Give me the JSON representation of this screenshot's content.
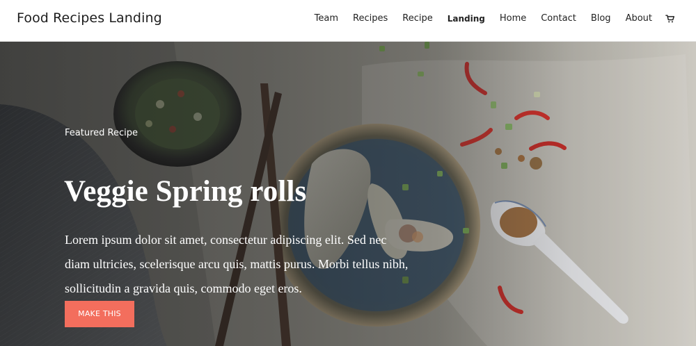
{
  "site": {
    "title": "Food Recipes Landing"
  },
  "nav": {
    "items": [
      {
        "label": "Team"
      },
      {
        "label": "Recipes"
      },
      {
        "label": "Recipe"
      },
      {
        "label": "Landing"
      },
      {
        "label": "Home"
      },
      {
        "label": "Contact"
      },
      {
        "label": "Blog"
      },
      {
        "label": "About"
      }
    ],
    "active": "Landing",
    "cart_icon": "cart-icon"
  },
  "hero": {
    "eyebrow": "Featured Recipe",
    "title": "Veggie Spring rolls",
    "body": "Lorem ipsum dolor sit amet, consectetur adipiscing elit. Sed nec diam ultricies, scelerisque arcu quis, mattis purus. Morbi tellus nibh, sollicitudin a gravida quis, commodo eget eros.",
    "cta_label": "MAKE THIS"
  },
  "colors": {
    "accent": "#f36e5d",
    "header_bg": "#ffffff",
    "header_text": "#1d1d1d",
    "hero_text": "#ffffff"
  }
}
